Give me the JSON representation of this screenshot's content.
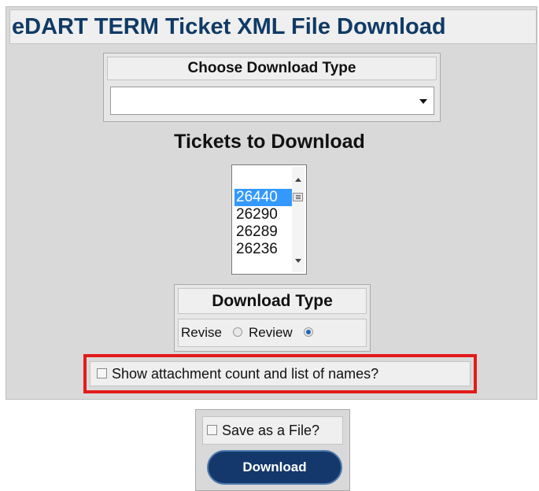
{
  "page": {
    "title": "eDART TERM Ticket XML File Download"
  },
  "choose": {
    "header": "Choose Download Type",
    "selected_value": ""
  },
  "tickets": {
    "header": "Tickets to Download",
    "items": [
      {
        "label": "26440",
        "selected": true
      },
      {
        "label": "26290",
        "selected": false
      },
      {
        "label": "26289",
        "selected": false
      },
      {
        "label": "26236",
        "selected": false
      }
    ]
  },
  "download_type": {
    "header": "Download Type",
    "options": [
      {
        "label": "Revise",
        "checked": false
      },
      {
        "label": "Review",
        "checked": true
      }
    ]
  },
  "attachments": {
    "label": "Show attachment count and list of names?",
    "checked": false,
    "highlight_color": "#e31b1b"
  },
  "save": {
    "label": "Save as a File?",
    "checked": false
  },
  "download_button": {
    "label": "Download"
  },
  "colors": {
    "title_text": "#103a66",
    "panel_bg": "#d9d9d9",
    "selection": "#3399ff",
    "button_bg": "#14386b"
  }
}
